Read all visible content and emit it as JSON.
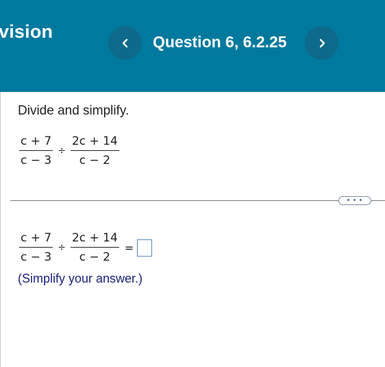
{
  "header": {
    "title": "vision",
    "question_label": "Question 6, 6.2.25",
    "prev_icon": "chevron-left-icon",
    "next_icon": "chevron-right-icon"
  },
  "problem": {
    "prompt": "Divide and simplify.",
    "frac1": {
      "num": "c + 7",
      "den": "c − 3"
    },
    "operator": "÷",
    "frac2": {
      "num": "2c + 14",
      "den": "c − 2"
    }
  },
  "divider": {
    "more_label": "• • •"
  },
  "answer": {
    "frac1": {
      "num": "c + 7",
      "den": "c − 3"
    },
    "operator": "÷",
    "frac2": {
      "num": "2c + 14",
      "den": "c − 2"
    },
    "equals": "=",
    "value": "",
    "hint": "(Simplify your answer.)"
  },
  "colors": {
    "header_bg": "#00799e",
    "nav_btn_bg": "#0d6a8a",
    "hint_text": "#1a237e",
    "answer_box_border": "#5a87b8"
  }
}
